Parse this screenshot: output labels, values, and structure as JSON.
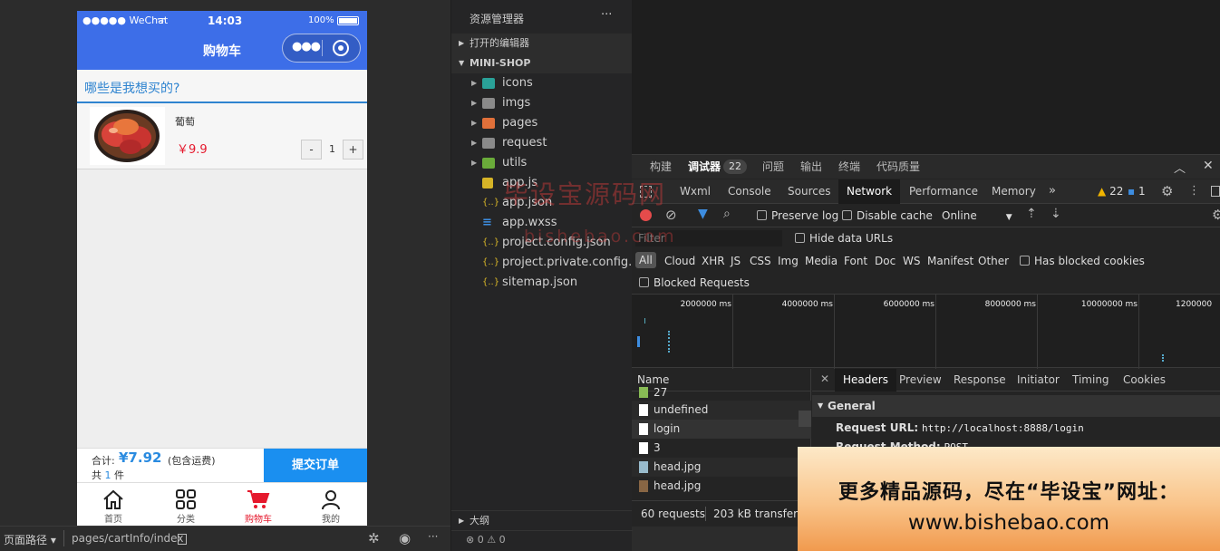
{
  "phone": {
    "status": {
      "signal": "●●●●● WeChat",
      "wifi": "ᯤ",
      "time": "14:03",
      "battery": "100%"
    },
    "nav_title": "购物车",
    "cart_title": "哪些是我想买的?",
    "item": {
      "name": "葡萄",
      "price": "￥9.9",
      "minus": "-",
      "qty": "1",
      "plus": "+"
    },
    "checkout": {
      "total_label": "合计:",
      "total": "¥7.92",
      "shipping": "(包含运费)",
      "count_prefix": "共",
      "count": "1",
      "count_suffix": "件",
      "submit": "提交订单"
    },
    "tabs": [
      {
        "label": "首页",
        "icon": "home-icon"
      },
      {
        "label": "分类",
        "icon": "grid-icon"
      },
      {
        "label": "购物车",
        "icon": "cart-icon"
      },
      {
        "label": "我的",
        "icon": "user-icon"
      }
    ],
    "accent": "#3d6ee8",
    "active_tab_color": "#e5192d"
  },
  "sim_footer": {
    "path_label": "页面路径",
    "path": "pages/cartInfo/index"
  },
  "explorer": {
    "title": "资源管理器",
    "more": "···",
    "open_editors": "打开的编辑器",
    "project": "MINI-SHOP",
    "outline": "大纲",
    "status": {
      "errors": "0",
      "warnings": "0"
    },
    "files": [
      {
        "name": "icons",
        "type": "folder"
      },
      {
        "name": "imgs",
        "type": "folder"
      },
      {
        "name": "pages",
        "type": "folder"
      },
      {
        "name": "request",
        "type": "folder"
      },
      {
        "name": "utils",
        "type": "folder"
      },
      {
        "name": "app.js",
        "type": "js"
      },
      {
        "name": "app.json",
        "type": "json"
      },
      {
        "name": "app.wxss",
        "type": "css"
      },
      {
        "name": "project.config.json",
        "type": "json"
      },
      {
        "name": "project.private.config.js...",
        "type": "json"
      },
      {
        "name": "sitemap.json",
        "type": "json"
      }
    ]
  },
  "devtools": {
    "top_tabs": [
      "构建",
      "调试器",
      "问题",
      "输出",
      "终端",
      "代码质量"
    ],
    "debugger_badge": "22",
    "panels": [
      "Wxml",
      "Console",
      "Sources",
      "Network",
      "Performance",
      "Memory"
    ],
    "more_panels": "»",
    "warn_count": "22",
    "info_count": "1",
    "toolbar": {
      "preserve_log": "Preserve log",
      "disable_cache": "Disable cache",
      "throttle": "Online"
    },
    "filter": {
      "placeholder": "Filter",
      "hide_data_urls": "Hide data URLs",
      "types": [
        "All",
        "Cloud",
        "XHR",
        "JS",
        "CSS",
        "Img",
        "Media",
        "Font",
        "Doc",
        "WS",
        "Manifest",
        "Other"
      ],
      "has_blocked": "Has blocked cookies",
      "blocked_requests": "Blocked Requests"
    },
    "timeline_ticks": [
      "2000000 ms",
      "4000000 ms",
      "6000000 ms",
      "8000000 ms",
      "10000000 ms",
      "1200000"
    ],
    "requests_header": "Name",
    "requests": [
      "27",
      "undefined",
      "login",
      "3",
      "head.jpg",
      "head.jpg"
    ],
    "detail_tabs": [
      "Headers",
      "Preview",
      "Response",
      "Initiator",
      "Timing",
      "Cookies"
    ],
    "general": {
      "title": "General",
      "url_key": "Request URL:",
      "url_val": "http://localhost:8888/login",
      "method_key": "Request Method:",
      "method_val": "POST"
    },
    "summary": {
      "requests": "60 requests",
      "transferred": "203 kB transferred"
    }
  },
  "watermark": {
    "cn": "毕设宝源码网",
    "en": "bishebao.com"
  },
  "ad": {
    "line1": "更多精品源码，尽在“毕设宝”网址：",
    "line2": "www.bishebao.com"
  }
}
